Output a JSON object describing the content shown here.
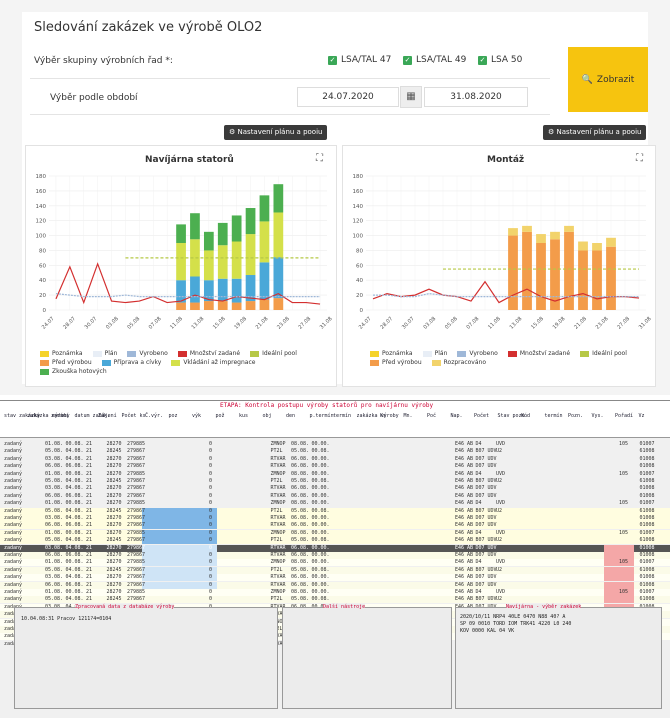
{
  "app": {
    "title": "Sledování zakázek ve výrobě OLO2",
    "group_label": "Výběr skupiny výrobních řad *:",
    "groups": [
      {
        "label": "LSA/TAL 47",
        "checked": true
      },
      {
        "label": "LSA/TAL 49",
        "checked": true
      },
      {
        "label": "LSA 50",
        "checked": true
      }
    ],
    "period_label": "Výběr podle období",
    "date_from": "24.07.2020",
    "date_to": "31.08.2020",
    "show_button": "Zobrazit",
    "plan_button": "Nastavení plánu a pooiu",
    "accent_color": "#f6c40f",
    "check_color": "#3aa757"
  },
  "charts": {
    "left": {
      "title": "Navíjárna statorů",
      "legend": [
        "Poznámka",
        "Plán",
        "Vyrobeno",
        "Množství zadané",
        "Ideální pool",
        "Před výrobou",
        "Příprava a cívky",
        "Vkládání až impregnace",
        "Zkouška hotových"
      ]
    },
    "right": {
      "title": "Montáž",
      "legend": [
        "Poznámka",
        "Plán",
        "Vyrobeno",
        "Množství zadané",
        "Ideální pool",
        "Před výrobou",
        "Rozpracováno"
      ]
    }
  },
  "chart_data": [
    {
      "type": "bar",
      "title": "Navíjárna statorů",
      "ylim": [
        0,
        180
      ],
      "yticks": [
        "180",
        "160",
        "140",
        "120",
        "100",
        "80",
        "60",
        "40",
        "20",
        "0"
      ],
      "categories": [
        "24.07",
        "26.07",
        "28.07",
        "30.07",
        "01.08",
        "03.08",
        "05.08",
        "07.08",
        "09.08",
        "11.08",
        "13.08",
        "15.08",
        "17.08",
        "19.08",
        "21.08",
        "23.08",
        "25.08",
        "27.08",
        "29.08",
        "31.08"
      ],
      "xticks": [
        "24.07",
        "28.07",
        "30.07",
        "03.08",
        "05.08",
        "07.08",
        "11.08",
        "13.08",
        "15.08",
        "19.08",
        "21.08",
        "23.08",
        "27.08",
        "31.08"
      ],
      "series": [
        {
          "name": "Před výrobou",
          "color": "#f39c4a",
          "values": [
            0,
            0,
            0,
            0,
            0,
            0,
            0,
            0,
            0,
            10,
            10,
            12,
            12,
            10,
            12,
            14,
            16,
            0,
            0,
            0
          ]
        },
        {
          "name": "Příprava a cívky",
          "color": "#4aa8d8",
          "values": [
            0,
            0,
            0,
            0,
            0,
            0,
            0,
            0,
            0,
            30,
            35,
            28,
            30,
            32,
            35,
            50,
            55,
            0,
            0,
            0
          ]
        },
        {
          "name": "Vkládání až impregnace",
          "color": "#d4e04a",
          "values": [
            0,
            0,
            0,
            0,
            0,
            0,
            0,
            0,
            0,
            50,
            50,
            40,
            45,
            50,
            55,
            55,
            60,
            0,
            0,
            0
          ]
        },
        {
          "name": "Zkouška hotových",
          "color": "#4caf50",
          "values": [
            0,
            0,
            0,
            0,
            0,
            0,
            0,
            0,
            0,
            25,
            35,
            25,
            30,
            35,
            35,
            35,
            38,
            0,
            0,
            0
          ]
        },
        {
          "name": "Množství zadané",
          "color": "#d32f2f",
          "type": "line",
          "values": [
            15,
            58,
            10,
            62,
            12,
            10,
            12,
            18,
            10,
            12,
            20,
            14,
            12,
            18,
            16,
            14,
            22,
            10,
            10,
            8
          ]
        },
        {
          "name": "Ideální pool",
          "color": "#b6c846",
          "type": "line",
          "values": [
            null,
            null,
            null,
            null,
            null,
            70,
            70,
            70,
            70,
            70,
            70,
            70,
            70,
            70,
            70,
            70,
            70,
            70,
            70,
            70
          ]
        },
        {
          "name": "Vyrobeno",
          "color": "#9fb8d8",
          "type": "line",
          "values": [
            22,
            20,
            18,
            18,
            18,
            20,
            18,
            18,
            18,
            18,
            18,
            18,
            18,
            18,
            18,
            18,
            18,
            18,
            18,
            18
          ]
        }
      ]
    },
    {
      "type": "bar",
      "title": "Montáž",
      "ylim": [
        0,
        180
      ],
      "yticks": [
        "180",
        "160",
        "140",
        "120",
        "100",
        "80",
        "60",
        "40",
        "20",
        "0"
      ],
      "categories": [
        "24.07",
        "26.07",
        "28.07",
        "30.07",
        "01.08",
        "03.08",
        "05.08",
        "07.08",
        "09.08",
        "11.08",
        "13.08",
        "15.08",
        "17.08",
        "19.08",
        "21.08",
        "23.08",
        "25.08",
        "27.08",
        "29.08",
        "31.08"
      ],
      "xticks": [
        "24.07",
        "28.07",
        "30.07",
        "03.08",
        "05.08",
        "07.08",
        "11.08",
        "13.08",
        "15.08",
        "19.08",
        "21.08",
        "23.08",
        "27.08",
        "31.08"
      ],
      "series": [
        {
          "name": "Před výrobou",
          "color": "#f39c4a",
          "values": [
            0,
            0,
            0,
            0,
            0,
            0,
            0,
            0,
            0,
            0,
            100,
            105,
            90,
            95,
            105,
            80,
            80,
            85,
            0,
            0
          ]
        },
        {
          "name": "Rozpracováno",
          "color": "#f2d36b",
          "values": [
            0,
            0,
            0,
            0,
            0,
            0,
            0,
            0,
            0,
            0,
            10,
            8,
            12,
            10,
            8,
            12,
            10,
            12,
            0,
            0
          ]
        },
        {
          "name": "Množství zadané",
          "color": "#d32f2f",
          "type": "line",
          "values": [
            15,
            22,
            18,
            20,
            28,
            20,
            18,
            12,
            38,
            10,
            20,
            28,
            18,
            12,
            18,
            22,
            15,
            18,
            18,
            16
          ]
        },
        {
          "name": "Ideální pool",
          "color": "#b6c846",
          "type": "line",
          "values": [
            null,
            null,
            null,
            null,
            null,
            55,
            55,
            55,
            55,
            55,
            55,
            55,
            55,
            55,
            55,
            55,
            55,
            55,
            55,
            55
          ]
        },
        {
          "name": "Vyrobeno",
          "color": "#9fb8d8",
          "type": "line",
          "values": [
            20,
            20,
            18,
            18,
            22,
            20,
            18,
            18,
            18,
            18,
            18,
            18,
            18,
            18,
            18,
            18,
            18,
            18,
            18,
            18
          ]
        }
      ]
    }
  ],
  "terminal": {
    "title": "ETAPA: Kontrola postupu výroby statorů pro navíjárnu výroby",
    "headers": [
      "stav zakázky",
      "zakázka výroby",
      "zadání",
      "datum zahájení",
      "Zák.",
      "Počet ks",
      "Č.výr.",
      "poz",
      "výk",
      "pož",
      "kus",
      "obj",
      "den",
      "p.termín",
      "termín",
      "zakázka výroby",
      "Ks",
      "Mn.",
      "Poč",
      "Nap.",
      "Počet",
      "Stav pozn.",
      "Kód",
      "termín",
      "Pozn.",
      "Vys.",
      "Pořadí",
      "Vz"
    ],
    "rows": [
      [
        "zadaný",
        "",
        "01.08.",
        "00.08.",
        "21",
        "28270",
        "279885",
        "",
        "",
        "",
        "0",
        "",
        "",
        "ZMNOP",
        "08.08.",
        "00.00.",
        "",
        "",
        "",
        "",
        "",
        "",
        "E46 AB",
        "D4",
        "UVD",
        "",
        "",
        "",
        "",
        "",
        "105",
        "01007"
      ],
      [
        "zadaný",
        "",
        "05.08.",
        "04.08.",
        "21",
        "28245",
        "279867",
        "",
        "",
        "",
        "0",
        "",
        "",
        "PT2L",
        "05.08.",
        "00.08.",
        "",
        "",
        "",
        "",
        "",
        "",
        "E46 AB",
        "B07 UDV",
        "U2",
        "",
        "",
        "",
        "",
        "",
        "",
        "61008"
      ],
      [
        "zadaný",
        "",
        "03.08.",
        "04.08.",
        "21",
        "28270",
        "279867",
        "",
        "",
        "",
        "0",
        "",
        "",
        "RTVAR",
        "06.08.",
        "00.00.",
        "",
        "",
        "",
        "",
        "",
        "",
        "E46 AB",
        "D07 UDV",
        "",
        "",
        "",
        "",
        "",
        "",
        "",
        "01008"
      ],
      [
        "zadaný",
        "",
        "06.08.",
        "06.08.",
        "21",
        "28270",
        "279867",
        "",
        "",
        "",
        "0",
        "",
        "",
        "RTVAR",
        "06.08.",
        "00.00.",
        "",
        "",
        "",
        "",
        "",
        "",
        "E46 AB",
        "D07 UDV",
        "",
        "",
        "",
        "",
        "",
        "",
        "",
        "01008"
      ]
    ]
  },
  "bottom_panes": {
    "left_title": "Zpracovaná data z databáze výroby",
    "left_text": "10.04.08:31  Pracov  1211?4=0104",
    "middle_title": "Další nástroje",
    "right_title": "Navíjárna - výběr zakázek",
    "right_text": [
      "2020/10/11  NRP4 40LE 0470 N88 40? A",
      "SP 09 0010 TORD IOM TRK41 4220 L0 240",
      "KOV 0000 KAL 04 VK"
    ]
  }
}
